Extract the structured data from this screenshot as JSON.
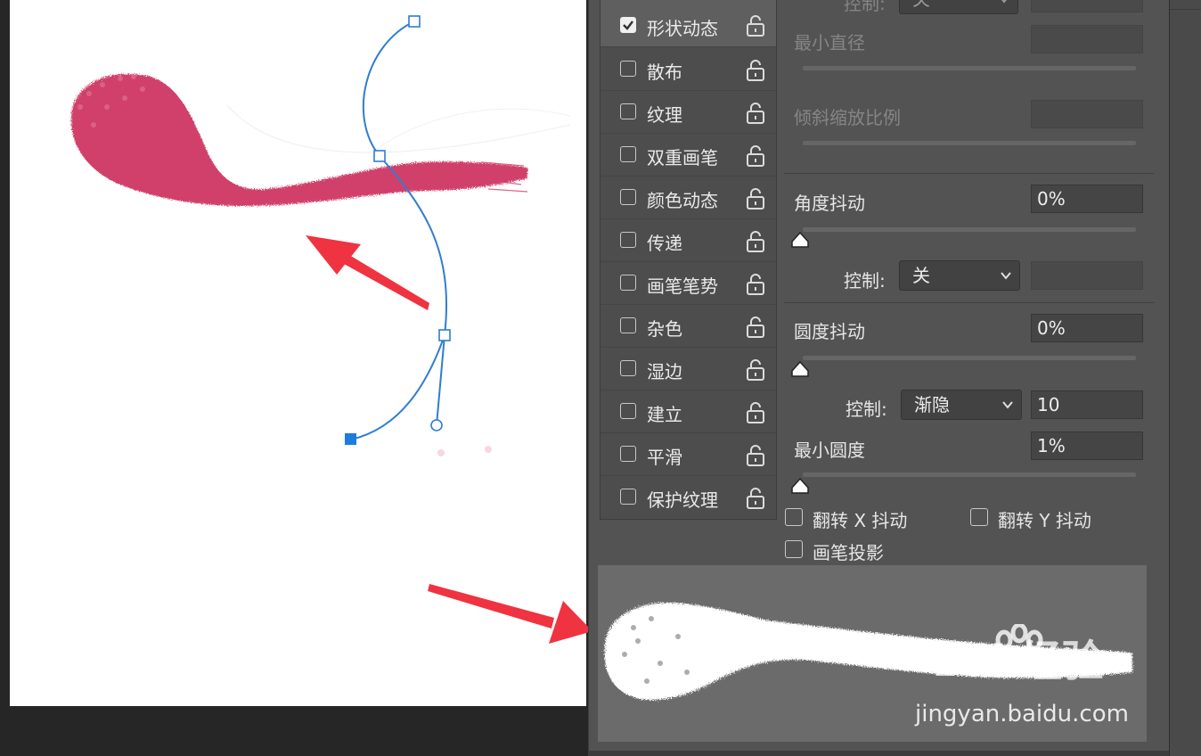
{
  "brush_options": [
    {
      "label": "形状动态",
      "checked": true
    },
    {
      "label": "散布",
      "checked": false
    },
    {
      "label": "纹理",
      "checked": false
    },
    {
      "label": "双重画笔",
      "checked": false
    },
    {
      "label": "颜色动态",
      "checked": false
    },
    {
      "label": "传递",
      "checked": false
    },
    {
      "label": "画笔笔势",
      "checked": false
    },
    {
      "label": "杂色",
      "checked": false
    },
    {
      "label": "湿边",
      "checked": false
    },
    {
      "label": "建立",
      "checked": false
    },
    {
      "label": "平滑",
      "checked": false
    },
    {
      "label": "保护纹理",
      "checked": false
    }
  ],
  "settings": {
    "top_control": {
      "label": "控制:",
      "value": "关"
    },
    "min_diameter": {
      "label": "最小直径",
      "value": ""
    },
    "tilt_scale": {
      "label": "倾斜缩放比例",
      "value": ""
    },
    "angle_jitter": {
      "label": "角度抖动",
      "value": "0%",
      "slider_level": 0
    },
    "angle_control": {
      "label": "控制:",
      "value": "关",
      "extra": ""
    },
    "roundness_jitter": {
      "label": "圆度抖动",
      "value": "0%",
      "slider_level": 0
    },
    "roundness_control": {
      "label": "控制:",
      "value": "渐隐",
      "extra": "10"
    },
    "min_roundness": {
      "label": "最小圆度",
      "value": "1%",
      "slider_level": 0.01
    },
    "flip_x": {
      "label": "翻转 X 抖动",
      "checked": false
    },
    "flip_y": {
      "label": "翻转 Y 抖动",
      "checked": false
    },
    "brush_projection": {
      "label": "画笔投影",
      "checked": false
    }
  },
  "watermark": {
    "logo": "Bai 经验",
    "url": "jingyan.baidu.com"
  },
  "colors": {
    "stroke": "#d0416b",
    "path": "#2f7dd1",
    "arrow": "#ef3340",
    "panel": "#535353",
    "preview_bg": "#6b6b6b"
  },
  "icons": [
    "checkmark-icon",
    "lock-icon",
    "chevron-down-icon",
    "slider-thumb-icon",
    "pen-anchor-icon",
    "arrow-annotation-icon",
    "baidu-paw-icon"
  ]
}
